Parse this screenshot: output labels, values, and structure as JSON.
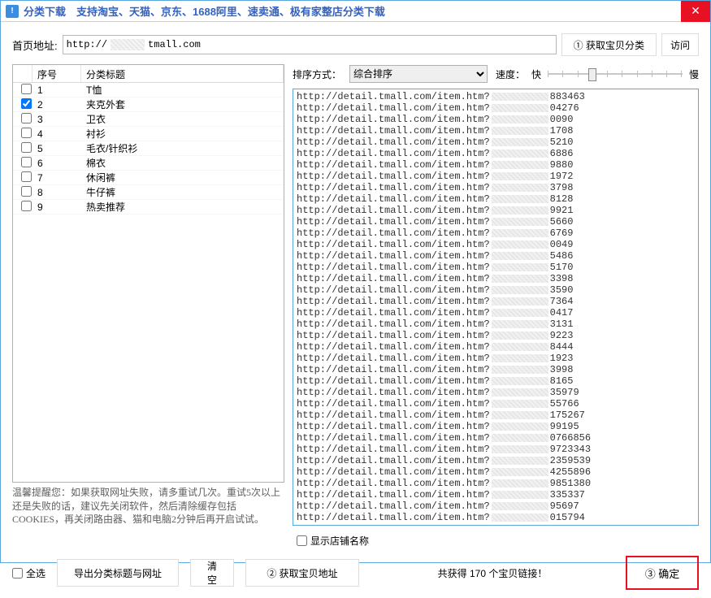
{
  "title": "分类下载　支持淘宝、天猫、京东、1688阿里、速卖通、极有家整店分类下载",
  "url_label": "首页地址:",
  "url": {
    "protocol": "http://",
    "host_masked": true,
    "rest": "tmall.com"
  },
  "btn_fetch_category": "① 获取宝贝分类",
  "btn_visit": "访问",
  "table": {
    "headers": {
      "seq": "序号",
      "title": "分类标题"
    },
    "rows": [
      {
        "seq": "1",
        "title": "T恤",
        "checked": false
      },
      {
        "seq": "2",
        "title": "夹克外套",
        "checked": true
      },
      {
        "seq": "3",
        "title": "卫衣",
        "checked": false
      },
      {
        "seq": "4",
        "title": "衬衫",
        "checked": false
      },
      {
        "seq": "5",
        "title": "毛衣/针织衫",
        "checked": false
      },
      {
        "seq": "6",
        "title": "棉衣",
        "checked": false
      },
      {
        "seq": "7",
        "title": "休闲裤",
        "checked": false
      },
      {
        "seq": "8",
        "title": "牛仔裤",
        "checked": false
      },
      {
        "seq": "9",
        "title": "热卖推荐",
        "checked": false
      }
    ]
  },
  "hint": "温馨提醒您：如果获取网址失败，请多重试几次。重试5次以上还是失败的话，建议先关闭软件，然后清除缓存包括COOKIES，再关闭路由器、猫和电脑2分钟后再开启试试。",
  "sort": {
    "label": "排序方式：",
    "selected": "综合排序",
    "options": [
      "综合排序"
    ]
  },
  "speed": {
    "label": "速度：",
    "fast": "快",
    "slow": "慢"
  },
  "links": {
    "prefix": "http://detail.tmall.com/item.htm?",
    "suffixes": [
      "883463",
      "04276",
      "0090",
      "1708",
      "5210",
      "6886",
      "9880",
      "1972",
      "3798",
      "8128",
      "9921",
      "5660",
      "6769",
      "0049",
      "5486",
      "5170",
      "3398",
      "3590",
      "7364",
      "0417",
      "3131",
      "9223",
      "8444",
      "1923",
      "3998",
      "8165",
      "35979",
      "55766",
      "175267",
      "99195",
      "0766856",
      "9723343",
      "2359539",
      "4255896",
      "9851380",
      "335337",
      "95697",
      "015794"
    ]
  },
  "show_shop_label": "显示店铺名称",
  "select_all": "全选",
  "btn_export": "导出分类标题与网址",
  "btn_clear": "清空",
  "btn_fetch_addr": "② 获取宝贝地址",
  "status_text": "共获得 170 个宝贝链接！",
  "btn_confirm": "③ 确定"
}
